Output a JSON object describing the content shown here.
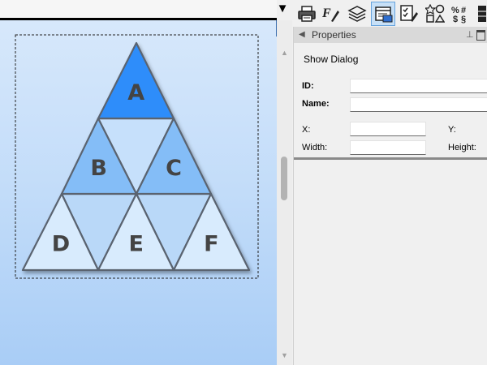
{
  "toolbar": {
    "dropdown": "dropdown-arrow-icon",
    "tools": [
      {
        "name": "printer-icon",
        "active": false
      },
      {
        "name": "format-painter-icon",
        "active": false
      },
      {
        "name": "layers-icon",
        "active": false
      },
      {
        "name": "properties-icon",
        "active": true
      },
      {
        "name": "checklist-icon",
        "active": false
      },
      {
        "name": "shapes-icon",
        "active": false
      },
      {
        "name": "number-format-icon",
        "active": false
      },
      {
        "name": "more-icon",
        "active": false
      }
    ]
  },
  "canvas": {
    "background_top": "#d7e8fb",
    "background_bottom": "#a9cdf6",
    "collapse_icon": "triangle-left-icon",
    "triangle_labels": [
      "A",
      "B",
      "C",
      "D",
      "E",
      "F"
    ],
    "colors": {
      "top": "#2e8dfa",
      "middle": "#84bdf7",
      "bottom": "#d8ebfd",
      "inverted_middle": "#c6e0fb",
      "inverted_bottom": "#b9d8f8",
      "stroke": "#5a6470",
      "label": "#444444"
    }
  },
  "properties": {
    "title": "Properties",
    "header_icon": "collapse-arrow-icon",
    "pin_icon": "pin-icon",
    "maximize_icon": "maximize-icon",
    "show_dialog": "Show Dialog",
    "id_label": "ID:",
    "name_label": "Name:",
    "x_label": "X:",
    "y_label": "Y:",
    "width_label": "Width:",
    "height_label": "Height:",
    "id_value": "",
    "name_value": "",
    "x_value": "",
    "width_value": ""
  }
}
